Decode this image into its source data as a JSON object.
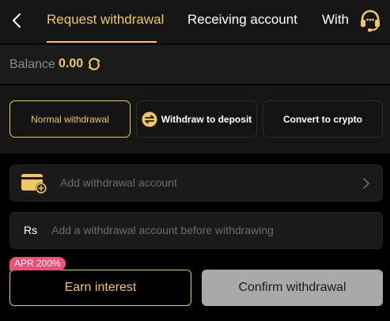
{
  "header": {
    "tabs": [
      {
        "label": "Request withdrawal",
        "active": true
      },
      {
        "label": "Receiving account",
        "active": false
      },
      {
        "label": "With",
        "active": false
      }
    ],
    "back_icon": "chevron-left-icon",
    "support_icon": "headset-icon"
  },
  "balance": {
    "label": "Balance",
    "value": "0.00",
    "refresh_icon": "refresh-icon"
  },
  "options": [
    {
      "label": "Normal withdrawal",
      "selected": true
    },
    {
      "label": "Withdraw to deposit",
      "selected": false,
      "icon": "swap-icon"
    },
    {
      "label": "Convert to crypto",
      "selected": false
    }
  ],
  "account_field": {
    "placeholder": "Add withdrawal account",
    "icon": "wallet-add-icon"
  },
  "amount_field": {
    "currency": "Rs",
    "placeholder": "Add a withdrawal account before withdrawing"
  },
  "actions": {
    "apr_badge": "APR 200%",
    "earn_label": "Earn interest",
    "confirm_label": "Confirm withdrawal"
  },
  "colors": {
    "accent": "#f3c65f",
    "badge": "#f04e7a",
    "disabled_button": "#a9a9a9"
  }
}
